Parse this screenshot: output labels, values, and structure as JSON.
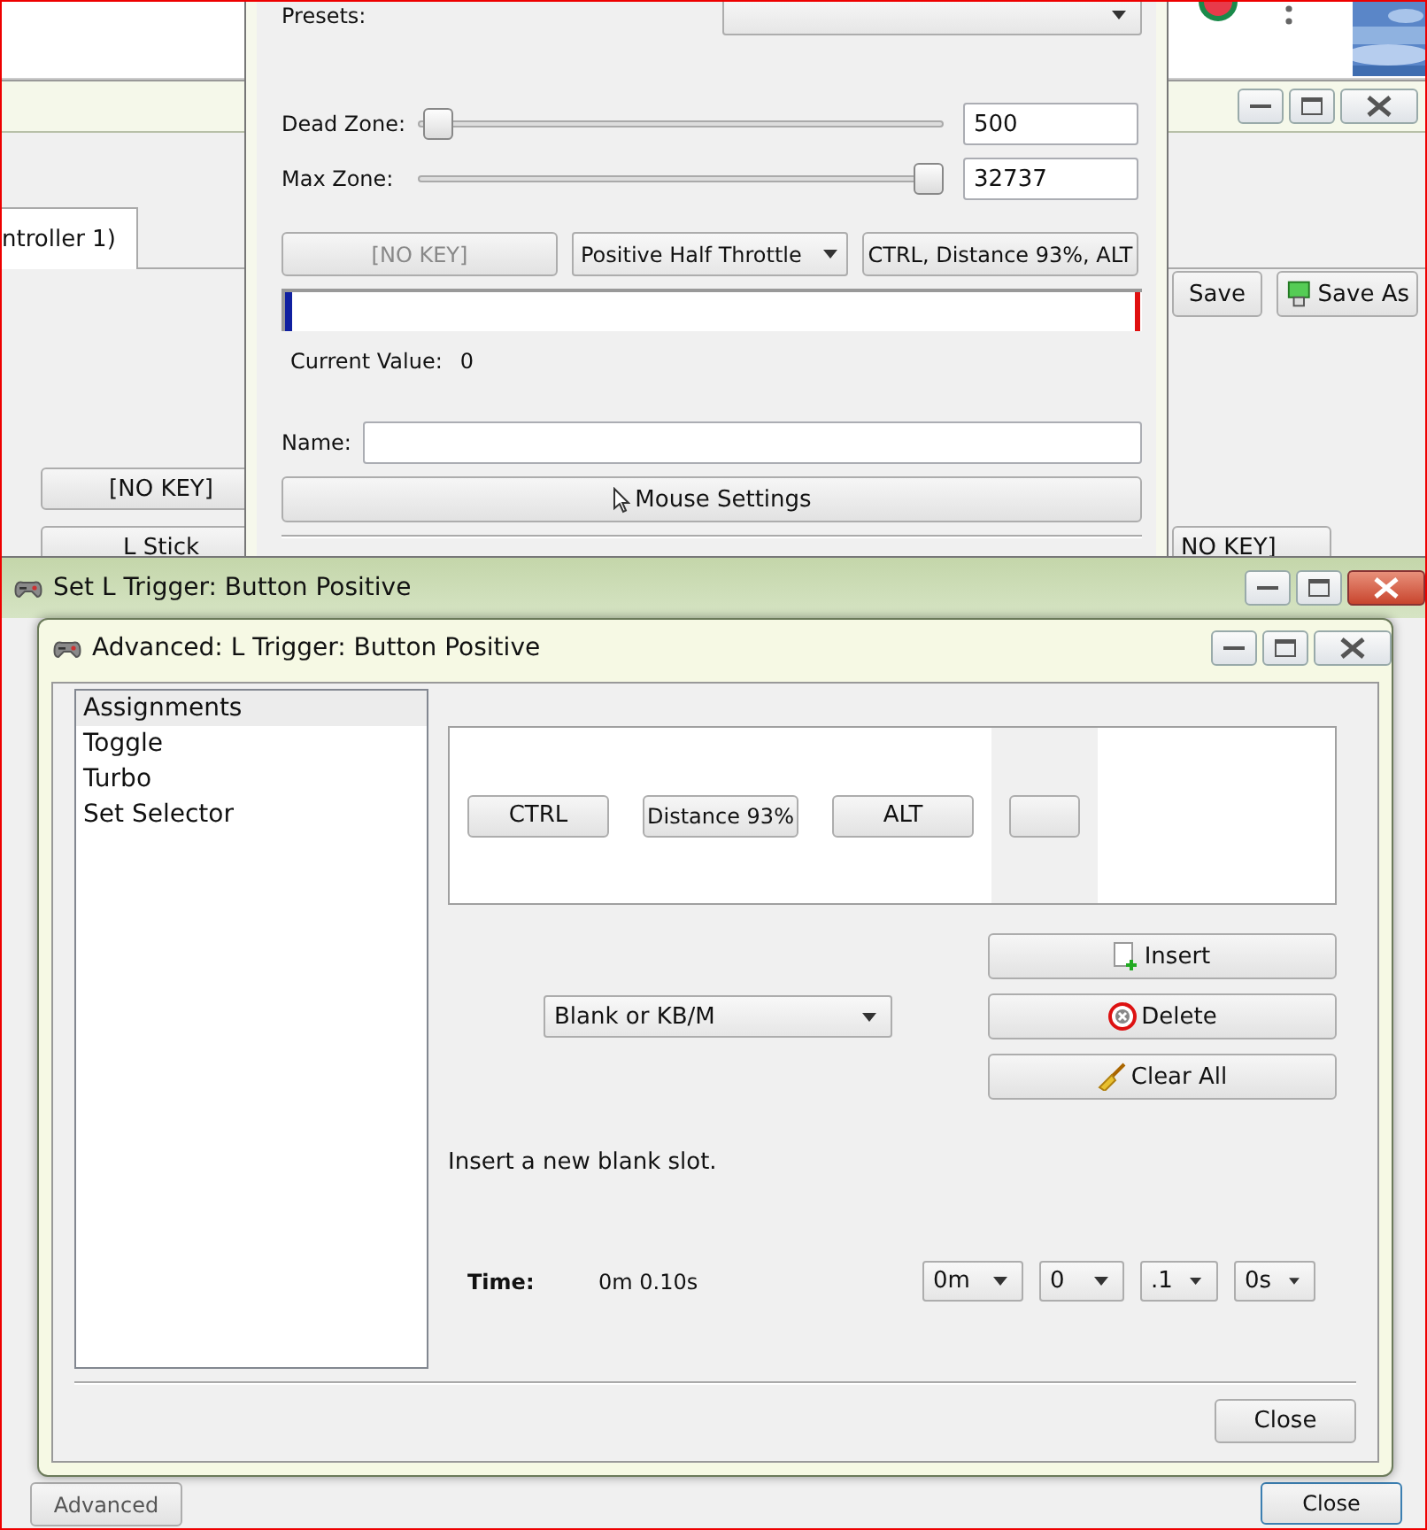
{
  "background_window": {
    "tab": {
      "label": "ntroller 1)",
      "selected": true
    },
    "toolbar_buttons": [
      {
        "label": "Save",
        "kind": "plain"
      },
      {
        "label": "Save As",
        "kind": "save_as"
      }
    ],
    "key_buttons": [
      "[NO KEY]",
      "L Stick",
      "NO KEY]"
    ]
  },
  "axis_window": {
    "presets_label": "Presets:",
    "dead_zone": {
      "label": "Dead Zone:",
      "level": 0.01,
      "value": "500"
    },
    "max_zone": {
      "label": "Max Zone:",
      "level": 1,
      "value": "32737"
    },
    "key_button": {
      "label": "[NO KEY]",
      "disabled": true
    },
    "throttle_select": "Positive Half Throttle",
    "assignment_button": "CTRL, Distance 93%, ALT",
    "current_value_label": "Current Value:",
    "current_value": "0",
    "name_label": "Name:",
    "mouse_settings_button": "Mouse Settings"
  },
  "set_window": {
    "title": "Set L Trigger: Button Positive",
    "advanced_button": "Advanced",
    "close_button": "Close"
  },
  "advanced_dialog": {
    "title": "Advanced: L Trigger: Button Positive",
    "sections": [
      {
        "label": "Assignments",
        "selected": true
      },
      {
        "label": "Toggle",
        "selected": false
      },
      {
        "label": "Turbo",
        "selected": false
      },
      {
        "label": "Set Selector",
        "selected": false
      }
    ],
    "slots": [
      "CTRL",
      "Distance 93%",
      "ALT"
    ],
    "empty_slot": true,
    "slot_type_select": "Blank or KB/M",
    "actions": [
      {
        "label": "Insert",
        "kind": "insert"
      },
      {
        "label": "Delete",
        "kind": "delete"
      },
      {
        "label": "Clear All",
        "kind": "clear"
      }
    ],
    "info": "Insert a new blank slot.",
    "time_label": "Time:",
    "time_value": "0m 0.10s",
    "time_selects": [
      "0m",
      "0",
      ".1",
      "0s"
    ],
    "close_button": "Close"
  }
}
